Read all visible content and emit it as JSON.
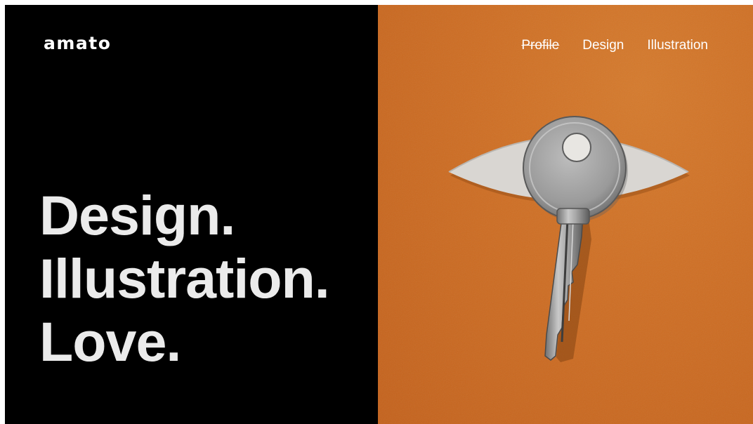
{
  "brand": {
    "logo": "amato"
  },
  "hero": {
    "lines": [
      "Design.",
      "Illustration.",
      "Love."
    ]
  },
  "nav": {
    "items": [
      {
        "label": "Profile",
        "state": "struck-through"
      },
      {
        "label": "Design",
        "state": "normal"
      },
      {
        "label": "Illustration",
        "state": "normal"
      }
    ]
  },
  "image": {
    "subject": "key-eye-artwork",
    "background_color": "#cf6f24"
  },
  "colors": {
    "left_background": "#000000",
    "headline_text": "#ebebeb",
    "accent_orange": "#cf6f24"
  }
}
